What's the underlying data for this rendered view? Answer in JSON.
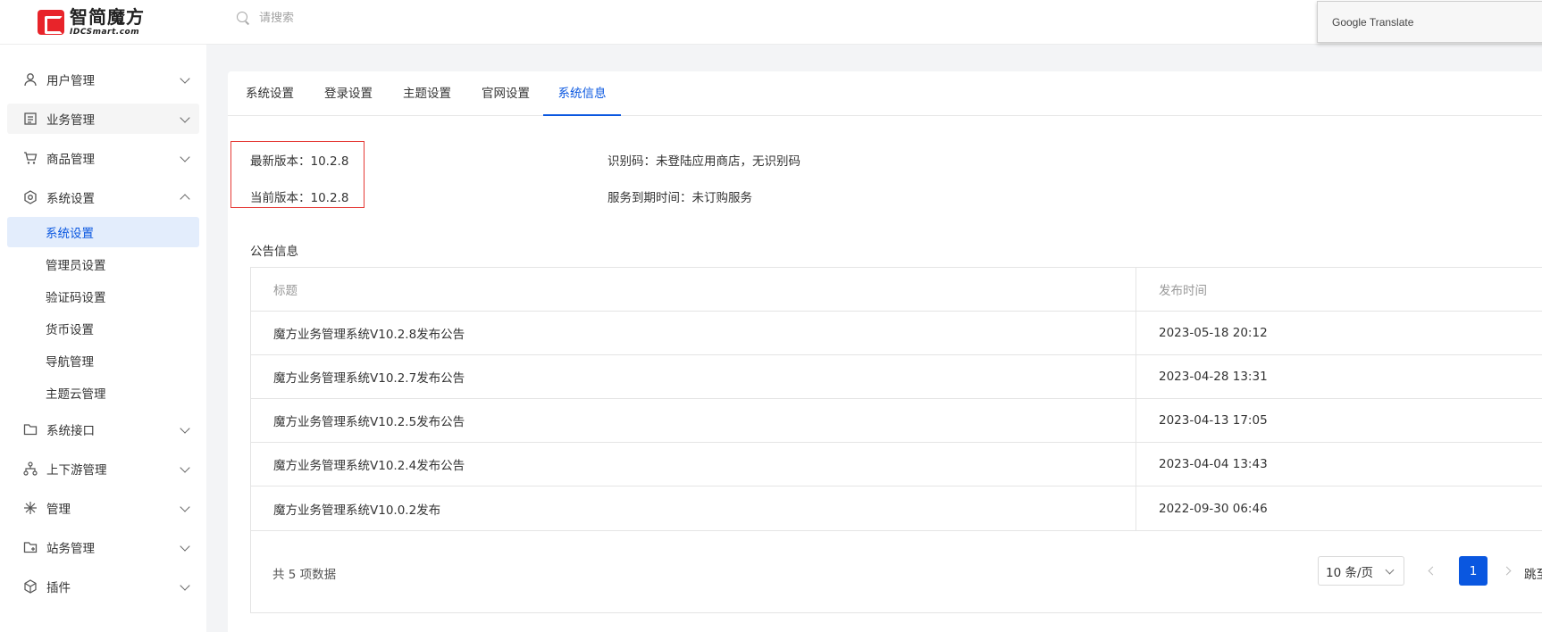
{
  "header": {
    "logo_title": "智简魔方",
    "logo_sub": "IDCSmart.com",
    "search_placeholder": "请搜索",
    "google_translate": "Google Translate"
  },
  "sidebar": {
    "items": [
      {
        "label": "用户管理",
        "icon": "user-icon"
      },
      {
        "label": "业务管理",
        "icon": "document-icon"
      },
      {
        "label": "商品管理",
        "icon": "cart-icon"
      },
      {
        "label": "系统设置",
        "icon": "settings-icon",
        "expanded": true
      },
      {
        "label": "系统接口",
        "icon": "folder-icon"
      },
      {
        "label": "上下游管理",
        "icon": "network-icon"
      },
      {
        "label": "管理",
        "icon": "snowflake-icon"
      },
      {
        "label": "站务管理",
        "icon": "folder-plus-icon"
      },
      {
        "label": "插件",
        "icon": "cube-icon"
      }
    ],
    "sub_items": [
      "系统设置",
      "管理员设置",
      "验证码设置",
      "货币设置",
      "导航管理",
      "主题云管理"
    ],
    "active_sub": "系统设置"
  },
  "tabs": [
    "系统设置",
    "登录设置",
    "主题设置",
    "官网设置",
    "系统信息"
  ],
  "active_tab": "系统信息",
  "info": {
    "latest_version": "最新版本：10.2.8",
    "current_version": "当前版本：10.2.8",
    "identifier": "识别码：未登陆应用商店，无识别码",
    "service_expiry": "服务到期时间：未订购服务"
  },
  "announcements": {
    "title": "公告信息",
    "columns": [
      "标题",
      "发布时间"
    ],
    "rows": [
      {
        "title": "魔方业务管理系统V10.2.8发布公告",
        "time": "2023-05-18 20:12"
      },
      {
        "title": "魔方业务管理系统V10.2.7发布公告",
        "time": "2023-04-28 13:31"
      },
      {
        "title": "魔方业务管理系统V10.2.5发布公告",
        "time": "2023-04-13 17:05"
      },
      {
        "title": "魔方业务管理系统V10.2.4发布公告",
        "time": "2023-04-04 13:43"
      },
      {
        "title": "魔方业务管理系统V10.0.2发布",
        "time": "2022-09-30 06:46"
      }
    ]
  },
  "pagination": {
    "total": "共 5 项数据",
    "page_size": "10 条/页",
    "current_page": "1",
    "jump": "跳至"
  },
  "colors": {
    "accent": "#0a57e0",
    "highlight_border": "#e53935",
    "logo_red": "#e8242a"
  }
}
